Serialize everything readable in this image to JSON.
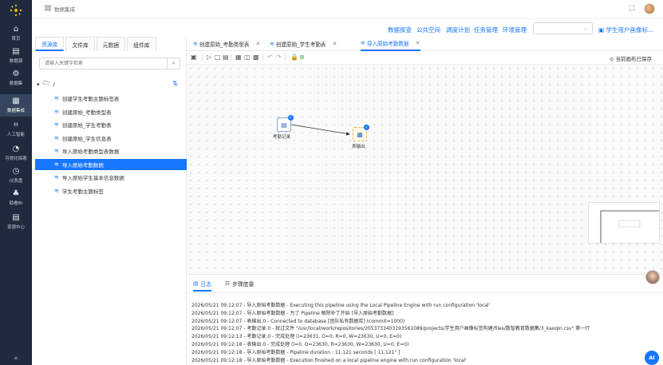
{
  "nav": {
    "items": [
      {
        "label": "首页",
        "icon": "home-icon",
        "glyph": "⌂"
      },
      {
        "label": "数据源",
        "icon": "database-icon",
        "glyph": "▤"
      },
      {
        "label": "数据集",
        "icon": "dataset-icon",
        "glyph": "⚙"
      },
      {
        "label": "数据集成",
        "icon": "integration-icon",
        "glyph": "▦"
      },
      {
        "label": "人工智能",
        "icon": "ai-icon",
        "glyph": "⌗"
      },
      {
        "label": "可视化探索",
        "icon": "chart-pie-icon",
        "glyph": "◔"
      },
      {
        "label": "仪表盘",
        "icon": "dashboard-icon",
        "glyph": "◷"
      },
      {
        "label": "助看BI",
        "icon": "org-icon",
        "glyph": "♣"
      },
      {
        "label": "资源中心",
        "icon": "resource-icon",
        "glyph": "▤"
      }
    ],
    "active_index": 3,
    "collapse_glyph": "«"
  },
  "topbar": {
    "breadcrumb": "数据集成",
    "fullscreen_glyph": "⛶"
  },
  "menubar": {
    "links": [
      "数据探查",
      "公共空间",
      "调度计划",
      "任务管理",
      "环境管理"
    ],
    "select_value": "",
    "user_label": "学生用户画像标..."
  },
  "resources": {
    "tabs": [
      "资源库",
      "文件库",
      "元数据",
      "组件库"
    ],
    "active_tab": 0,
    "search_placeholder": "请输入关键字检索",
    "root_label": "/",
    "items": [
      "创建学生考勤主题标签表",
      "创建原始_考勤类型表",
      "创建原始_学生考勤表",
      "创建原始_学生信息表",
      "导入原始考勤类型表数据",
      "导入原始考勤数据",
      "导入原始学生基本信息数据",
      "学生考勤主题标签"
    ],
    "active_item": 5
  },
  "editor": {
    "tabs": [
      {
        "label": "创建原始_考勤类型表",
        "active": false
      },
      {
        "label": "创建原始_学生考勤表",
        "active": false
      },
      {
        "label": "导入原始考勤数据",
        "active": true
      }
    ],
    "saved_label": "当前画布已保存"
  },
  "canvas": {
    "nodes": [
      {
        "label": "考勤记录",
        "glyph": "▤"
      },
      {
        "label": "表输出",
        "glyph": "▦"
      }
    ]
  },
  "log": {
    "tabs": [
      "日志",
      "步骤度量"
    ],
    "active_tab": 0,
    "lines": [
      "2026/05/21 09:12:07 - 导入原始考勤数据 - Executing this pipeline using the Local Pipeline Engine with run configuration 'local'",
      "2026/05/21 09:12:07 - 导入原始考勤数据 - 为了 Pipeline 解除补丁开始 [导入原始考勤数据]",
      "2026/05/21 09:12:07 - 表输出.0 - Connected to database [团队私有数据库] (commit=1000)",
      "2026/05/21 09:12:07 - 考勤记录.0 - 就过文件 \"/usr/local/work/repositories/2053733403193561089/projects/学生用户画像标签构建/files/数智教育数据集/3_kaoqin.csv\" 第一行",
      "2026/05/21 09:12:13 - 考勤记录.0 - 完成处理 (I=23631, O=0, R=0, W=23630, U=0, E=0)",
      "2026/05/21 09:12:18 - 表输出.0 - 完成处理 (I=0, O=23630, R=23630, W=23630, U=0, E=0)",
      "2026/05/21 09:12:18 - 导入原始考勤数据 - Pipeline duration : 11.121 seconds [ 11.121\" ]",
      "2026/05/21 09:12:18 - 导入原始考勤数据 - Execution finished on a local pipeline engine with run configuration 'local'"
    ],
    "ai_label": "AI"
  }
}
